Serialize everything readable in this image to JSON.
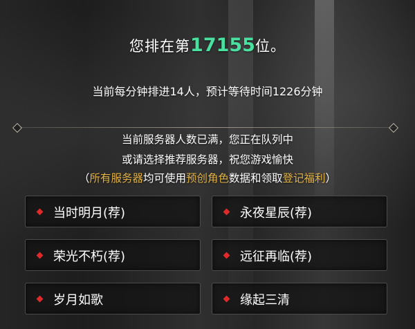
{
  "queue": {
    "rank_prefix": "您排在第",
    "rank_number": "17155",
    "rank_suffix": "位。",
    "rate_text": "当前每分钟排进14人，预计等待时间1226分钟"
  },
  "notice": {
    "line1": "当前服务器人数已满，您正在队列中",
    "line2": "或请选择推荐服务器，祝您游戏愉快",
    "line3_open": "（",
    "line3_highlight1": "所有服务器",
    "line3_text1": "均可使用",
    "line3_highlight2": "预创角色",
    "line3_text2": "数据和领取",
    "line3_highlight3": "登记福利",
    "line3_close": "）"
  },
  "servers": [
    {
      "label": "当时明月(荐)"
    },
    {
      "label": "永夜星辰(荐)"
    },
    {
      "label": "荣光不朽(荐)"
    },
    {
      "label": "远征再临(荐)"
    },
    {
      "label": "岁月如歌"
    },
    {
      "label": "缘起三清"
    }
  ],
  "colors": {
    "rank_number": "#49e0a0",
    "highlight": "#e3b345",
    "server_dot": "#e02a2a"
  }
}
